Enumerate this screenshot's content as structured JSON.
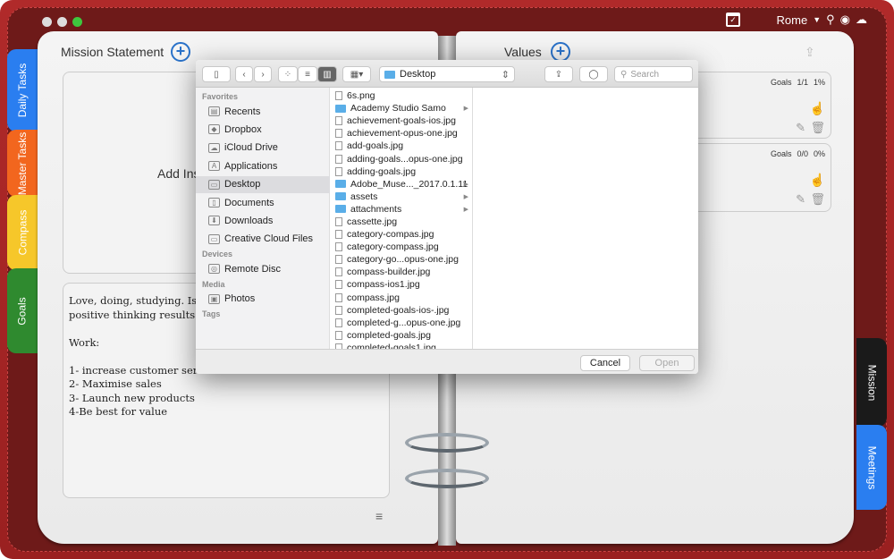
{
  "window": {
    "location": "Rome"
  },
  "left_tabs": [
    {
      "label": "Daily Tasks",
      "color": "#2a7ef0"
    },
    {
      "label": "Master Tasks",
      "color": "#f2661e"
    },
    {
      "label": "Compass",
      "color": "#f6c72a"
    },
    {
      "label": "Goals",
      "color": "#2f8a2f"
    }
  ],
  "right_tabs": [
    {
      "label": "Mission",
      "color": "#1a1a1a"
    },
    {
      "label": "Meetings",
      "color": "#2a7ef0"
    }
  ],
  "mission": {
    "title": "Mission Statement",
    "add_prompt": "Add Ins",
    "note": "Love, doing, studying. Is\npositive thinking results\n\nWork:\n\n1- increase customer ser\n2- Maximise sales\n3- Launch new products\n4-Be best for value"
  },
  "values": {
    "title": "Values",
    "cards": [
      {
        "goals_label": "Goals",
        "count": "1/1",
        "percent": "1%"
      },
      {
        "goals_label": "Goals",
        "count": "0/0",
        "percent": "0%"
      }
    ]
  },
  "dialog": {
    "location": "Desktop",
    "search_placeholder": "Search",
    "sidebar": [
      {
        "header": "Favorites",
        "items": [
          "Recents",
          "Dropbox",
          "iCloud Drive",
          "Applications",
          "Desktop",
          "Documents",
          "Downloads",
          "Creative Cloud Files"
        ]
      },
      {
        "header": "Devices",
        "items": [
          "Remote Disc"
        ]
      },
      {
        "header": "Media",
        "items": [
          "Photos"
        ]
      },
      {
        "header": "Tags",
        "items": []
      }
    ],
    "selected_sidebar": "Desktop",
    "files": [
      {
        "name": "6s.png",
        "folder": false
      },
      {
        "name": "Academy Studio Samo",
        "folder": true
      },
      {
        "name": "achievement-goals-ios.jpg",
        "folder": false
      },
      {
        "name": "achievement-opus-one.jpg",
        "folder": false
      },
      {
        "name": "add-goals.jpg",
        "folder": false
      },
      {
        "name": "adding-goals...opus-one.jpg",
        "folder": false
      },
      {
        "name": "adding-goals.jpg",
        "folder": false
      },
      {
        "name": "Adobe_Muse..._2017.0.1.11",
        "folder": true
      },
      {
        "name": "assets",
        "folder": true
      },
      {
        "name": "attachments",
        "folder": true
      },
      {
        "name": "cassette.jpg",
        "folder": false
      },
      {
        "name": "category-compas.jpg",
        "folder": false
      },
      {
        "name": "category-compass.jpg",
        "folder": false
      },
      {
        "name": "category-go...opus-one.jpg",
        "folder": false
      },
      {
        "name": "compass-builder.jpg",
        "folder": false
      },
      {
        "name": "compass-ios1.jpg",
        "folder": false
      },
      {
        "name": "compass.jpg",
        "folder": false
      },
      {
        "name": "completed-goals-ios-.jpg",
        "folder": false
      },
      {
        "name": "completed-g...opus-one.jpg",
        "folder": false
      },
      {
        "name": "completed-goals.jpg",
        "folder": false
      },
      {
        "name": "completed-goals1.jpg",
        "folder": false
      }
    ],
    "cancel": "Cancel",
    "open": "Open"
  }
}
